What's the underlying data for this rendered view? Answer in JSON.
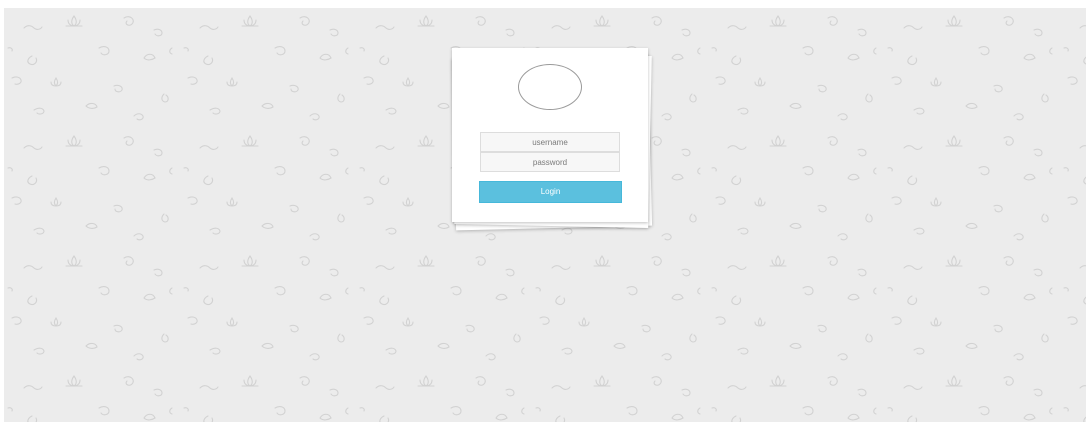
{
  "login": {
    "username_placeholder": "username",
    "password_placeholder": "password",
    "login_label": "Login"
  },
  "colors": {
    "background": "#ececec",
    "pattern": "#d2d2d2",
    "button": "#5bc0de",
    "card": "#ffffff"
  },
  "icons": {
    "avatar": "avatar-circle-icon",
    "background_pattern": "floral-pattern-icon"
  }
}
